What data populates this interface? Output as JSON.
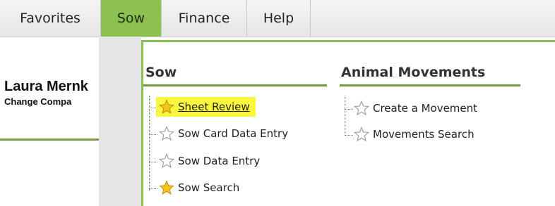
{
  "menubar": {
    "items": [
      {
        "label": "Favorites",
        "active": false
      },
      {
        "label": "Sow",
        "active": true
      },
      {
        "label": "Finance",
        "active": false
      },
      {
        "label": "Help",
        "active": false
      }
    ]
  },
  "page": {
    "user_name": "Laura Mernk",
    "change_company": "Change Compa"
  },
  "dropdown": {
    "sections": [
      {
        "title": "Sow",
        "items": [
          {
            "label": "Sheet Review",
            "favorite": true,
            "highlighted": true
          },
          {
            "label": "Sow Card Data Entry",
            "favorite": false,
            "highlighted": false
          },
          {
            "label": "Sow Data Entry",
            "favorite": false,
            "highlighted": false
          },
          {
            "label": "Sow Search",
            "favorite": true,
            "highlighted": false
          }
        ]
      },
      {
        "title": "Animal Movements",
        "items": [
          {
            "label": "Create a Movement",
            "favorite": false,
            "highlighted": false
          },
          {
            "label": "Movements Search",
            "favorite": false,
            "highlighted": false
          }
        ]
      }
    ]
  },
  "colors": {
    "accent_green": "#8cc152",
    "section_underline": "#6f9a3e",
    "highlight_yellow": "#f9f73c",
    "favorite_star": "#f6c51c"
  }
}
